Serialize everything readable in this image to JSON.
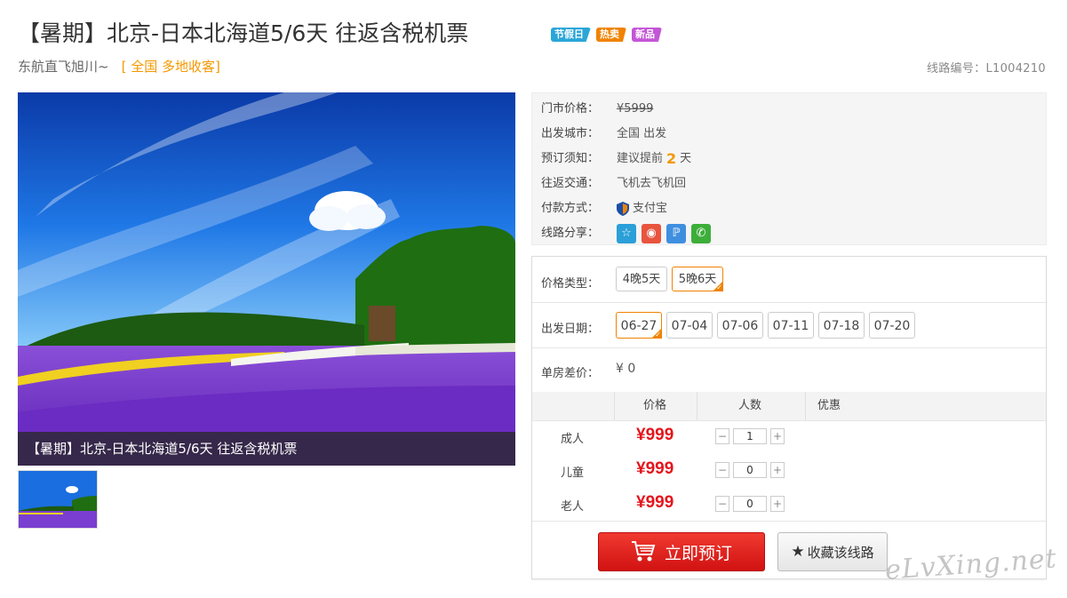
{
  "page": {
    "title": "【暑期】北京-日本北海道5/6天 往返含税机票",
    "tags": [
      {
        "label": "节假日",
        "color": "#2aa6d8"
      },
      {
        "label": "热卖",
        "color": "#f08300"
      },
      {
        "label": "新品",
        "color": "#c356d6"
      }
    ],
    "subtitle": "东航直飞旭川~",
    "region": "[ 全国 多地收客]",
    "route_code_label": "线路编号：",
    "route_code": "L1004210"
  },
  "photo": {
    "caption": "【暑期】北京-日本北海道5/6天 往返含税机票"
  },
  "info": {
    "market_price_label": "门市价格：",
    "market_price": "¥5999",
    "departure_city_label": "出发城市：",
    "departure_city": "全国 出发",
    "booking_note_label": "预订须知：",
    "booking_note_prefix": "建议提前",
    "booking_note_days": "2",
    "booking_note_suffix": "天",
    "transport_label": "往返交通：",
    "transport": "飞机去飞机回",
    "payment_label": "付款方式：",
    "payment": "支付宝",
    "share_label": "线路分享："
  },
  "booking": {
    "price_type_label": "价格类型：",
    "price_types": [
      "4晚5天",
      "5晚6天"
    ],
    "departure_date_label": "出发日期：",
    "dates": [
      "06-27",
      "07-04",
      "07-06",
      "07-11",
      "07-18",
      "07-20"
    ],
    "single_room_label": "单房差价：",
    "single_room_value": "¥ 0",
    "table_headers": [
      "价格",
      "人数",
      "优惠"
    ],
    "rows": [
      {
        "who": "成人",
        "price": "¥999",
        "count": "1"
      },
      {
        "who": "儿童",
        "price": "¥999",
        "count": "0"
      },
      {
        "who": "老人",
        "price": "¥999",
        "count": "0"
      }
    ],
    "book_button": "立即预订",
    "fav_button": "收藏该线路"
  },
  "watermark": "eLvXing.net"
}
